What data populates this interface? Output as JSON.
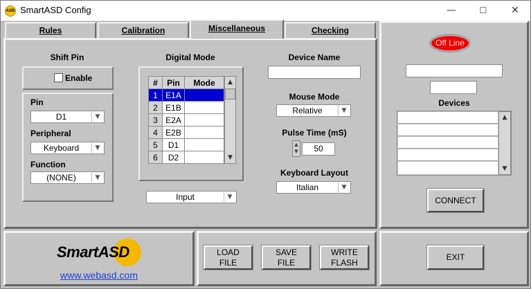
{
  "window": {
    "title": "SmartASD Config",
    "icon_text": "ASD",
    "minimize": "—",
    "maximize": "☐",
    "close": "✕"
  },
  "tabs": [
    {
      "label": "Rules",
      "active": false
    },
    {
      "label": "Calibration",
      "active": false
    },
    {
      "label": "Miscellaneous",
      "active": true
    },
    {
      "label": "Checking",
      "active": false
    }
  ],
  "shift_pin": {
    "title": "Shift Pin",
    "enable_label": "Enable",
    "enable_checked": false,
    "pin_label": "Pin",
    "pin_value": "D1",
    "peripheral_label": "Peripheral",
    "peripheral_value": "Keyboard",
    "function_label": "Function",
    "function_value": "(NONE)"
  },
  "digital_mode": {
    "title": "Digital Mode",
    "columns": [
      "#",
      "Pin",
      "Mode"
    ],
    "rows": [
      {
        "num": "1",
        "pin": "E1A",
        "mode": "",
        "selected": true
      },
      {
        "num": "2",
        "pin": "E1B",
        "mode": ""
      },
      {
        "num": "3",
        "pin": "E2A",
        "mode": ""
      },
      {
        "num": "4",
        "pin": "E2B",
        "mode": ""
      },
      {
        "num": "5",
        "pin": "D1",
        "mode": ""
      },
      {
        "num": "6",
        "pin": "D2",
        "mode": ""
      }
    ],
    "mode_select": "Input"
  },
  "device": {
    "name_label": "Device Name",
    "name_value": "",
    "mouse_mode_label": "Mouse Mode",
    "mouse_mode_value": "Relative",
    "pulse_time_label": "Pulse Time (mS)",
    "pulse_time_value": "50",
    "keyboard_layout_label": "Keyboard Layout",
    "keyboard_layout_value": "Italian"
  },
  "status": {
    "led_text": "Off Line",
    "field1": "",
    "field2": "",
    "devices_label": "Devices",
    "devices": [
      "",
      "",
      "",
      "",
      ""
    ],
    "connect_label": "CONNECT"
  },
  "footer": {
    "logo_text": "SmartASD",
    "link": "www.webasd.com",
    "load_file": [
      "LOAD",
      "FILE"
    ],
    "save_file": [
      "SAVE",
      "FILE"
    ],
    "write_flash": [
      "WRITE",
      "FLASH"
    ],
    "exit_label": "EXIT"
  },
  "colors": {
    "led": "#ee0000",
    "selected_row": "#0000d0",
    "link": "#1f3fd6",
    "logo_badge": "#f5b800"
  }
}
